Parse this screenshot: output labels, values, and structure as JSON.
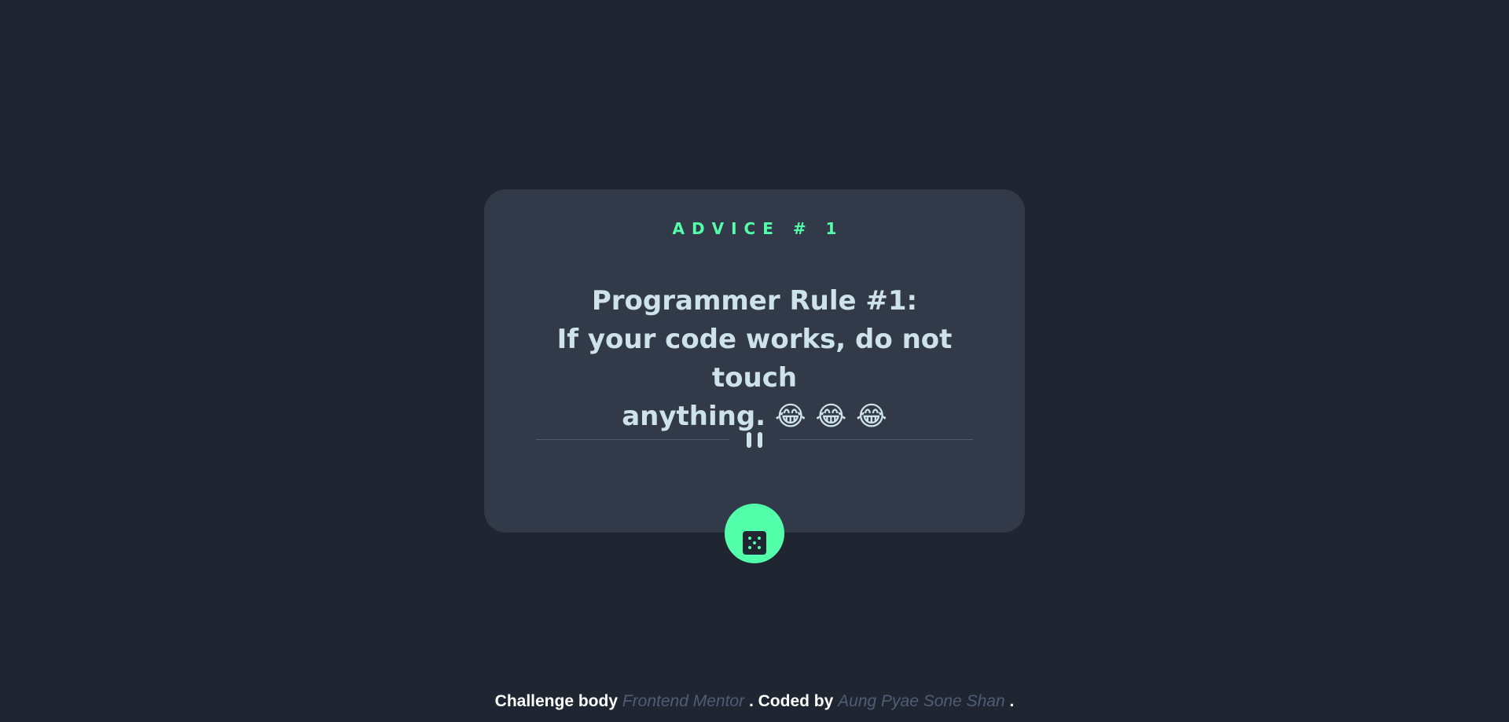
{
  "card": {
    "advice_label": "ADVICE # 1",
    "quote_lines": [
      "Programmer Rule #1:",
      "If your code works, do not touch",
      "anything. 😂 😂 😂"
    ]
  },
  "divider": {
    "icon": "pause-icon"
  },
  "dice_button": {
    "icon": "dice-icon"
  },
  "footer": {
    "prefix": "Challenge body",
    "link1": "Frontend Mentor",
    "middle": ". Coded by",
    "link2": "Aung Pyae Sone Shan",
    "suffix": "."
  },
  "colors": {
    "background": "#1f2632",
    "card": "#323a49",
    "accent": "#53ffaa",
    "text": "#cee3e9",
    "muted": "#4f5d74"
  }
}
